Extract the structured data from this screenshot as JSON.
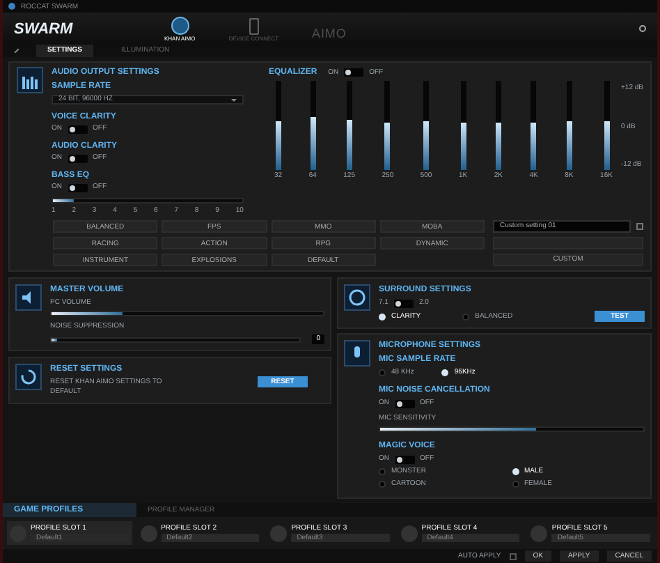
{
  "window": {
    "title": "ROCCAT SWARM"
  },
  "header": {
    "logo": "SWARM",
    "devices": [
      {
        "label": "KHAN AIMO",
        "selected": true,
        "kind": "headset"
      },
      {
        "label": "DEVICE CONNECT",
        "selected": false,
        "kind": "phone"
      },
      {
        "label": "AIMO",
        "selected": false,
        "kind": "text"
      }
    ]
  },
  "tabs": [
    {
      "label": "SETTINGS",
      "selected": true
    },
    {
      "label": "ILLUMINATION",
      "selected": false
    }
  ],
  "audio_output": {
    "title": "AUDIO OUTPUT SETTINGS",
    "sample_rate_label": "SAMPLE RATE",
    "sample_rate": "24 BIT, 96000 HZ",
    "toggles": [
      {
        "label": "VOICE CLARITY",
        "on_label": "ON",
        "off_label": "OFF",
        "on": true
      },
      {
        "label": "AUDIO CLARITY",
        "on_label": "ON",
        "off_label": "OFF",
        "on": true
      },
      {
        "label": "BASS EQ",
        "on_label": "ON",
        "off_label": "OFF",
        "on": true
      }
    ],
    "bass": {
      "level": 0.11
    },
    "bass_ticks": [
      "1",
      "2",
      "3",
      "4",
      "5",
      "6",
      "7",
      "8",
      "9",
      "10"
    ],
    "equalizer": {
      "label": "EQUALIZER",
      "on_label": "ON",
      "off_label": "OFF",
      "on": true,
      "db_labels": [
        "+12 dB",
        "0 dB",
        "-12 dB"
      ],
      "bands": [
        {
          "label": "32",
          "level": 0.55
        },
        {
          "label": "64",
          "level": 0.6
        },
        {
          "label": "125",
          "level": 0.56
        },
        {
          "label": "250",
          "level": 0.53
        },
        {
          "label": "500",
          "level": 0.54
        },
        {
          "label": "1K",
          "level": 0.53
        },
        {
          "label": "2K",
          "level": 0.53
        },
        {
          "label": "4K",
          "level": 0.53
        },
        {
          "label": "8K",
          "level": 0.55
        },
        {
          "label": "16K",
          "level": 0.55
        }
      ]
    },
    "presets": [
      {
        "label": "BALANCED",
        "selected": false
      },
      {
        "label": "FPS",
        "selected": false
      },
      {
        "label": "MMO",
        "selected": false
      },
      {
        "label": "MOBA",
        "selected": false
      },
      {
        "label": "RACING",
        "selected": false
      },
      {
        "label": "ACTION",
        "selected": false
      },
      {
        "label": "RPG",
        "selected": false
      },
      {
        "label": "DYNAMIC",
        "selected": false
      },
      {
        "label": "INSTRUMENT",
        "selected": false
      },
      {
        "label": "EXPLOSIONS",
        "selected": false
      },
      {
        "label": "DEFAULT",
        "selected": false
      }
    ],
    "custom_name": "Custom setting 01",
    "custom_button": "CUSTOM"
  },
  "master_volume": {
    "title": "MASTER VOLUME",
    "pc_volume_label": "PC VOLUME",
    "pc_volume": {
      "level": 0.26
    },
    "noise_label": "NOISE SUPPRESSION",
    "noise": {
      "level": 0.02
    },
    "noise_value": "0"
  },
  "surround": {
    "title": "SURROUND SETTINGS",
    "on_label": "7.1",
    "off_label": "2.0",
    "on": true,
    "options": [
      {
        "label": "CLARITY",
        "selected": true
      },
      {
        "label": "BALANCED",
        "selected": false
      }
    ],
    "test_button": "TEST"
  },
  "reset": {
    "title": "RESET SETTINGS",
    "text": "RESET KHAN AIMO SETTINGS TO DEFAULT",
    "button": "RESET"
  },
  "microphone": {
    "title": "MICROPHONE SETTINGS",
    "sample_rate_label": "MIC SAMPLE RATE",
    "rates": [
      {
        "label": "48 KHz",
        "selected": false
      },
      {
        "label": "96KHz",
        "selected": true
      }
    ],
    "noise_cancel": {
      "label": "MIC NOISE CANCELLATION",
      "on_label": "ON",
      "off_label": "OFF",
      "on": true
    },
    "sensitivity_label": "MIC SENSITIVITY",
    "sensitivity": {
      "level": 0.59
    },
    "magic_voice": {
      "label": "MAGIC VOICE",
      "on_label": "ON",
      "off_label": "OFF",
      "on": true
    },
    "voices": [
      {
        "label": "MONSTER",
        "selected": false
      },
      {
        "label": "MALE",
        "selected": true
      },
      {
        "label": "CARTOON",
        "selected": false
      },
      {
        "label": "FEMALE",
        "selected": false
      }
    ]
  },
  "profiles": {
    "tabs": [
      {
        "label": "GAME PROFILES",
        "selected": true
      },
      {
        "label": "PROFILE MANAGER",
        "selected": false
      }
    ],
    "slots": [
      {
        "name": "PROFILE SLOT 1",
        "value": "Default1",
        "selected": true
      },
      {
        "name": "PROFILE SLOT 2",
        "value": "Default2",
        "selected": false
      },
      {
        "name": "PROFILE SLOT 3",
        "value": "Default3",
        "selected": false
      },
      {
        "name": "PROFILE SLOT 4",
        "value": "Default4",
        "selected": false
      },
      {
        "name": "PROFILE SLOT 5",
        "value": "Default5",
        "selected": false
      }
    ]
  },
  "footer": {
    "auto_apply_label": "AUTO APPLY",
    "auto_apply": false,
    "buttons": [
      "OK",
      "APPLY",
      "CANCEL"
    ]
  }
}
